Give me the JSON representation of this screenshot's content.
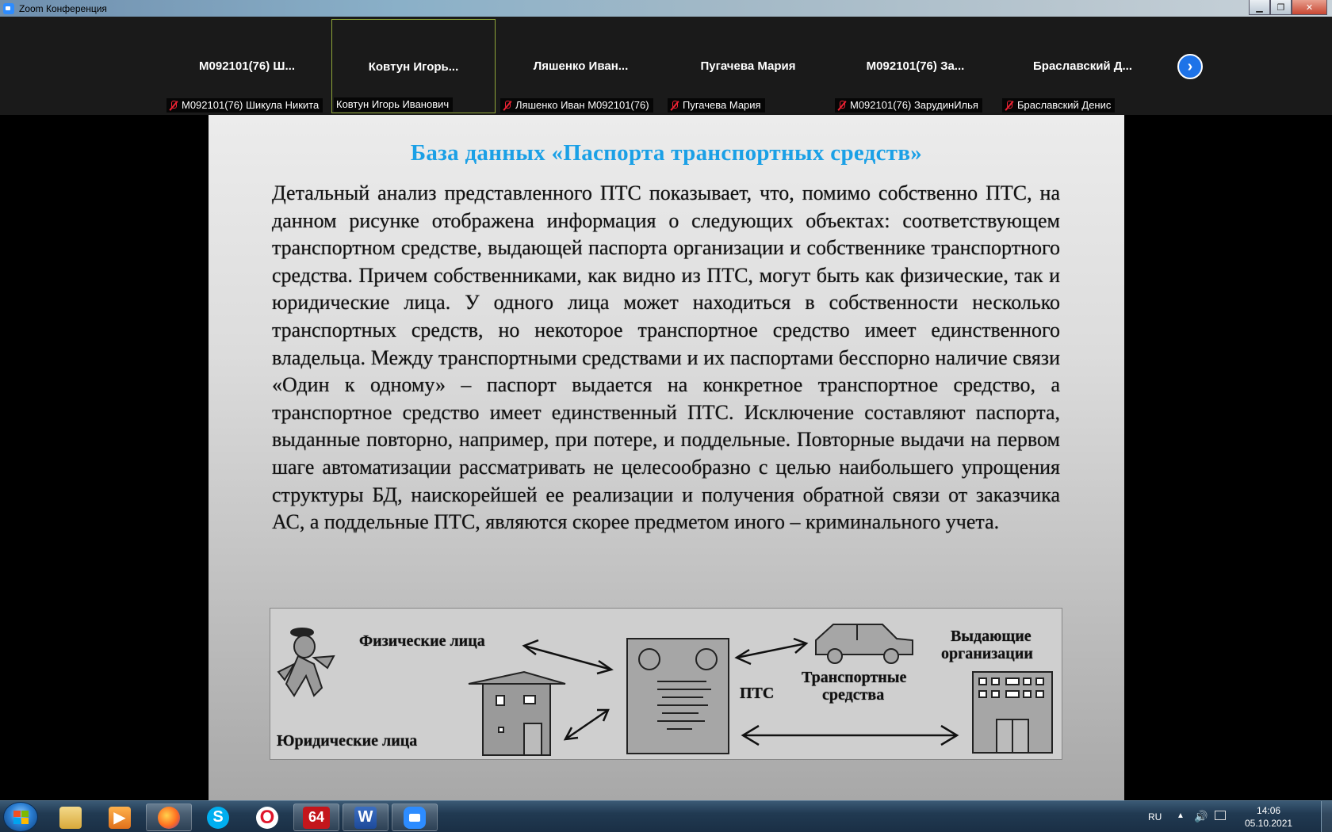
{
  "window": {
    "title": "Zoom Конференция",
    "minimize": "▁",
    "maximize": "❐",
    "close": "✕"
  },
  "gallery": {
    "participants": [
      {
        "name": "M092101(76) Ш...",
        "label": "M092101(76) Шикула Никита",
        "muted": true
      },
      {
        "name": "Ковтун  Игорь...",
        "label": "Ковтун Игорь Иванович",
        "muted": false,
        "active": true
      },
      {
        "name": "Ляшенко  Иван...",
        "label": "Ляшенко Иван M092101(76)",
        "muted": true
      },
      {
        "name": "Пугачева Мария",
        "label": "Пугачева Мария",
        "muted": true
      },
      {
        "name": "M092101(76) За...",
        "label": "M092101(76) ЗарудинИлья",
        "muted": true
      },
      {
        "name": "Браславский  Д...",
        "label": "Браславский Денис",
        "muted": true
      }
    ],
    "next_label": "›"
  },
  "slide": {
    "title": "База данных «Паспорта транспортных средств»",
    "body": "Детальный анализ представленного ПТС показывает, что, помимо собственно ПТС, на данном рисунке отображена информация о следующих объектах: соответствующем транспортном средстве, выдающей паспорта организации и собственнике транспортного средства. Причем собственниками, как видно из ПТС, могут быть как физические, так и юридические лица. У одного лица может находиться в собственности несколько транспортных средств, но некоторое транспортное средство имеет единственного владельца. Между транспортными средствами и их паспортами бесспорно наличие связи «Один к одному» – паспорт выдается на конкретное транспортное средство, а транспортное средство имеет единственный ПТС. Исключение составляют паспорта, выданные повторно, например, при потере, и поддельные. Повторные выдачи на первом шаге автоматизации рассматривать не целесообразно с целью наибольшего упрощения структуры БД, наискорейшей ее реализации и получения обратной связи от заказчика АС, а поддельные ПТС, являются скорее предметом иного – криминального учета.",
    "diagram": {
      "physical": "Физические лица",
      "legal": "Юридические лица",
      "pts": "ПТС",
      "vehicles_1": "Транспортные",
      "vehicles_2": "средства",
      "issuers_1": "Выдающие",
      "issuers_2": "организации"
    }
  },
  "taskbar": {
    "apps": [
      {
        "name": "explorer",
        "icon": "folder-icon"
      },
      {
        "name": "media-player",
        "icon": "media-icon"
      },
      {
        "name": "firefox",
        "icon": "firefox-icon",
        "open": true
      },
      {
        "name": "skype",
        "icon": "skype-icon",
        "glyph": "S"
      },
      {
        "name": "opera",
        "icon": "opera-icon",
        "glyph": "O"
      },
      {
        "name": "aida64",
        "icon": "aida64-icon",
        "glyph": "64",
        "open": true
      },
      {
        "name": "word",
        "icon": "word-icon",
        "glyph": "W",
        "open": true
      },
      {
        "name": "zoom",
        "icon": "zoom-icon",
        "open": true
      }
    ],
    "tray": {
      "lang": "RU",
      "time": "14:06",
      "date": "05.10.2021"
    }
  }
}
